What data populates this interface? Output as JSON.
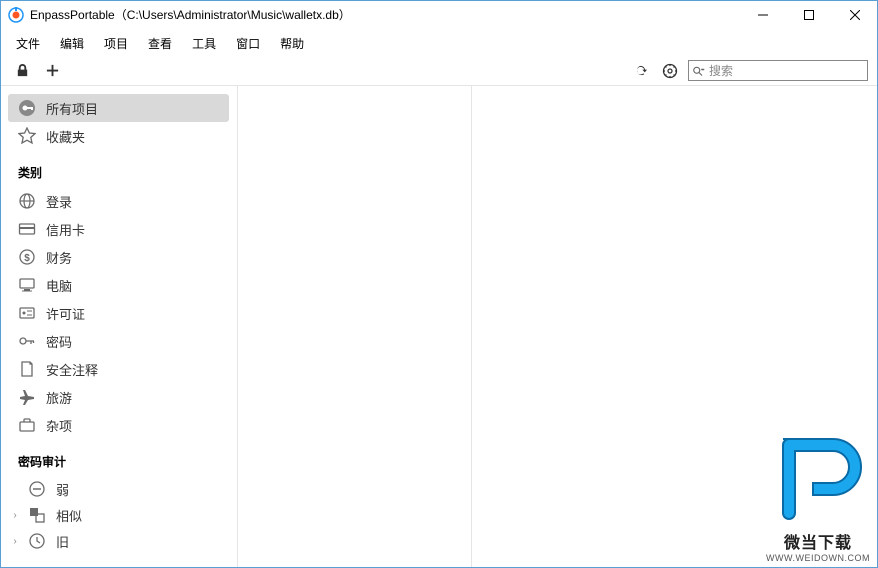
{
  "title": "EnpassPortable（C:\\Users\\Administrator\\Music\\walletx.db）",
  "menus": {
    "file": "文件",
    "edit": "编辑",
    "item": "项目",
    "view": "查看",
    "tools": "工具",
    "window": "窗口",
    "help": "帮助"
  },
  "search": {
    "placeholder": "搜索"
  },
  "sidebar": {
    "all_items": "所有项目",
    "favorites": "收藏夹",
    "section_categories": "类别",
    "cat_login": "登录",
    "cat_creditcard": "信用卡",
    "cat_finance": "财务",
    "cat_computer": "电脑",
    "cat_license": "许可证",
    "cat_password": "密码",
    "cat_securenote": "安全注释",
    "cat_travel": "旅游",
    "cat_misc": "杂项",
    "section_audit": "密码审计",
    "audit_weak": "弱",
    "audit_similar": "相似",
    "audit_old": "旧"
  },
  "watermark": {
    "text": "微当下载",
    "url": "WWW.WEIDOWN.COM"
  }
}
